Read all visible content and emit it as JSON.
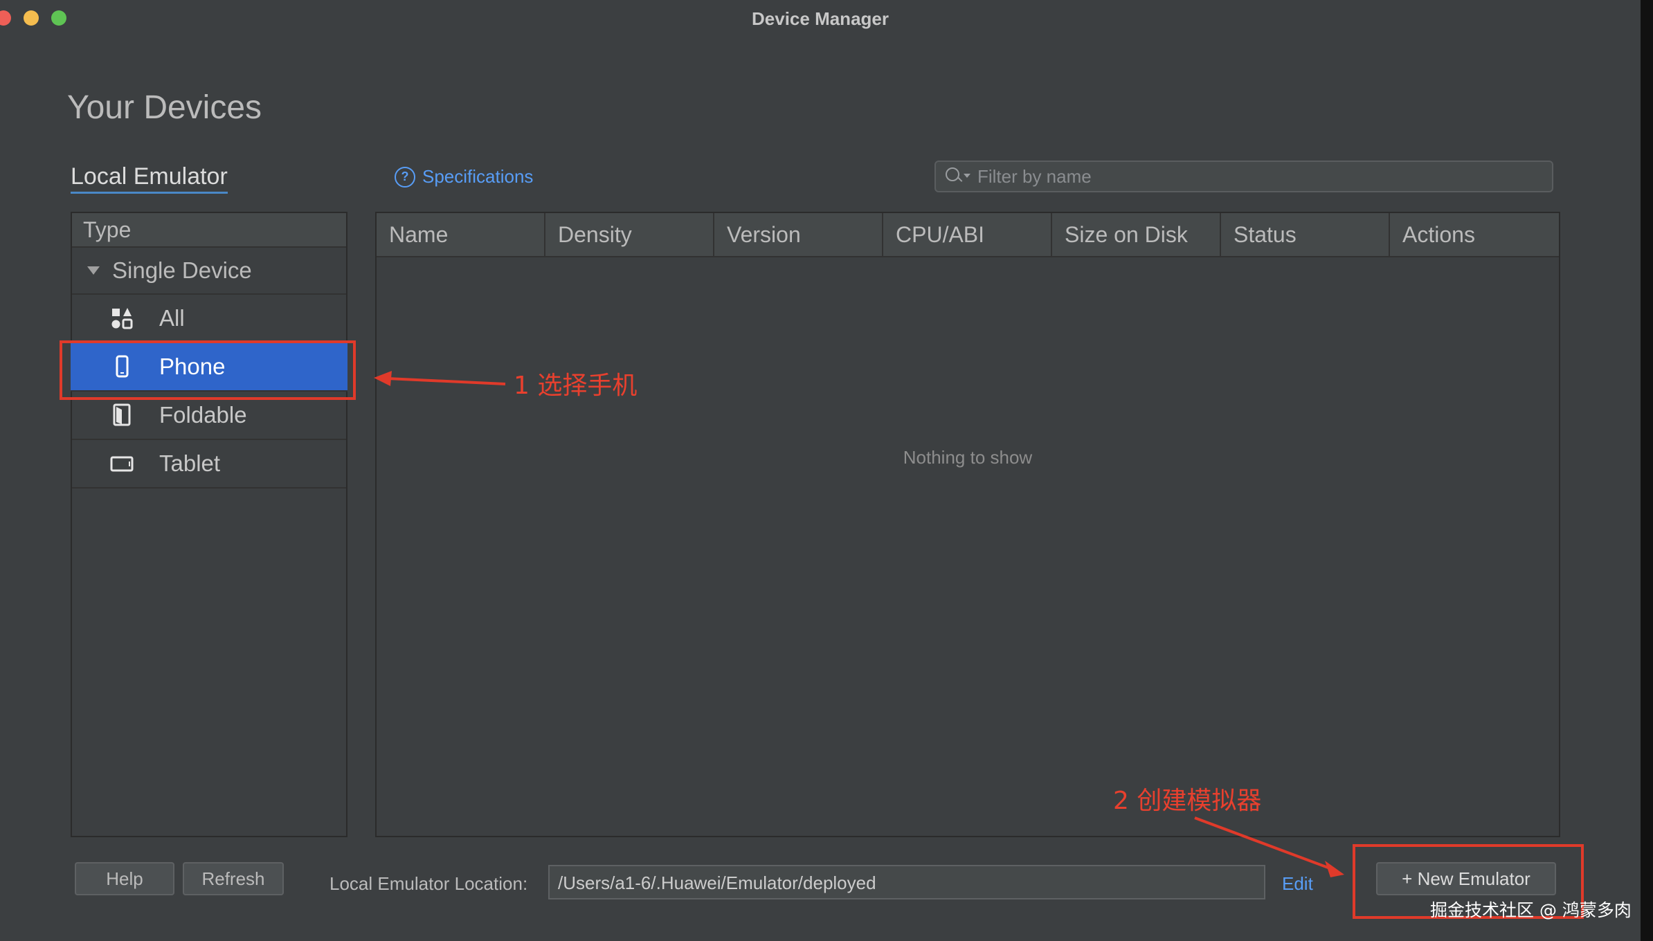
{
  "window": {
    "title": "Device Manager"
  },
  "page": {
    "heading": "Your Devices"
  },
  "tabs": {
    "local_emulator": "Local Emulator",
    "specifications": "Specifications"
  },
  "filter": {
    "placeholder": "Filter by name"
  },
  "sidebar": {
    "header": "Type",
    "group": "Single Device",
    "items": [
      {
        "label": "All",
        "icon": "grid-shapes-icon"
      },
      {
        "label": "Phone",
        "icon": "phone-icon",
        "selected": true
      },
      {
        "label": "Foldable",
        "icon": "foldable-icon"
      },
      {
        "label": "Tablet",
        "icon": "tablet-icon"
      }
    ]
  },
  "table": {
    "columns": [
      "Name",
      "Density",
      "Version",
      "CPU/ABI",
      "Size on Disk",
      "Status",
      "Actions"
    ],
    "empty_text": "Nothing to show"
  },
  "footer": {
    "help_label": "Help",
    "refresh_label": "Refresh",
    "location_label": "Local Emulator Location:",
    "location_value": "/Users/a1-6/.Huawei/Emulator/deployed",
    "edit_label": "Edit",
    "new_emulator_label": "+ New Emulator"
  },
  "annotations": {
    "step1": "1 选择手机",
    "step2": "2 创建模拟器",
    "color": "#e03a2a"
  },
  "watermark": "掘金技术社区 @ 鸿蒙多肉",
  "colors": {
    "background": "#3c3f41",
    "selection": "#2f65ca",
    "link": "#589df6"
  }
}
